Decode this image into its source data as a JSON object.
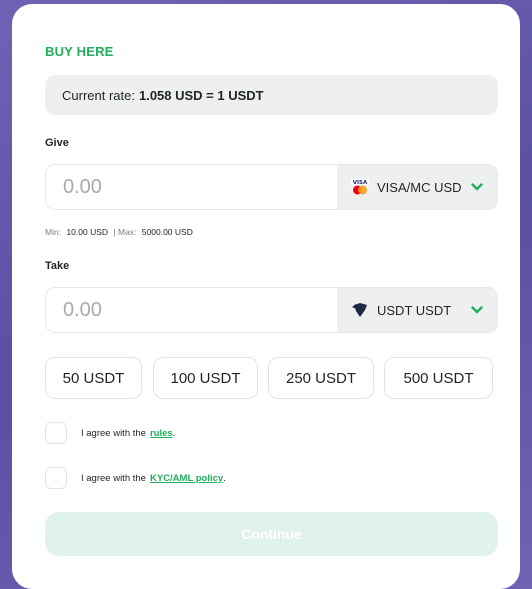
{
  "card": {
    "title": "BUY HERE",
    "rate_prefix": "Current rate:",
    "rate_value": "1.058 USD = 1 USDT"
  },
  "give": {
    "label": "Give",
    "placeholder": "0.00",
    "currency": "VISA/MC USD",
    "currency_icon": "visa-mastercard-icon",
    "limits": {
      "min_label": "Min:",
      "min_value": "10.00 USD",
      "separator": "|",
      "max_label": "Max:",
      "max_value": "5000.00 USD"
    }
  },
  "take": {
    "label": "Take",
    "placeholder": "0.00",
    "currency": "USDT USDT",
    "currency_icon": "usdt-icon"
  },
  "quick_amounts": [
    "50 USDT",
    "100 USDT",
    "250 USDT",
    "500 USDT"
  ],
  "agreements": [
    {
      "text": "I agree with the",
      "link": "rules",
      "suffix": "."
    },
    {
      "text": "I agree with the",
      "link": "KYC/AML policy",
      "suffix": "."
    }
  ],
  "continue_label": "Continue",
  "colors": {
    "accent": "#1fae59",
    "background": "#6e63b4",
    "continue_disabled": "#dff3ea"
  }
}
